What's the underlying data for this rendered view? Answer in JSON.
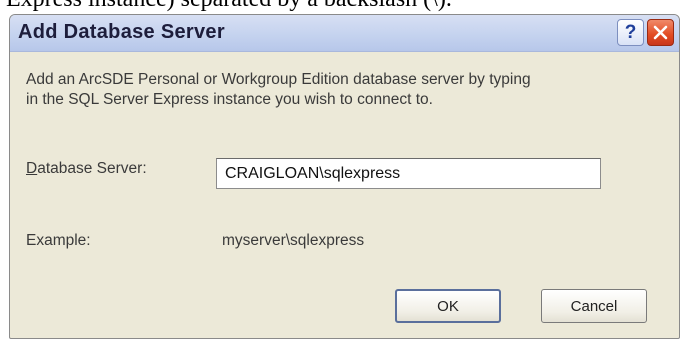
{
  "caption_fragment": "Express instance) separated by a backslash (\\).",
  "dialog": {
    "title": "Add Database Server",
    "help_glyph": "?",
    "description_line1": "Add an ArcSDE Personal or Workgroup Edition database server by typing",
    "description_line2": "in the SQL Server Express instance you wish to connect to.",
    "server_label_access_key": "D",
    "server_label_rest": "atabase Server:",
    "server_value": "CRAIGLOAN\\sqlexpress",
    "example_label": "Example:",
    "example_value": "myserver\\sqlexpress",
    "ok_label": "OK",
    "cancel_label": "Cancel"
  },
  "colors": {
    "dialog_face": "#ece9d8",
    "title_text": "#1d1d3b",
    "close_button": "#e24b22",
    "default_button_border": "#5a6f9c"
  }
}
